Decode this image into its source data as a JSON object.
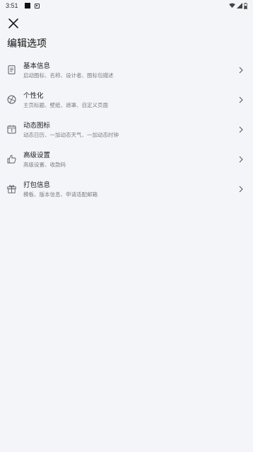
{
  "status": {
    "time": "3:51",
    "icons": [
      "notification-square-icon",
      "notification-box-icon",
      "wifi-icon",
      "signal-icon",
      "battery-icon"
    ]
  },
  "header": {
    "close_icon": "close-icon",
    "title": "编辑选项"
  },
  "menu": [
    {
      "icon": "document-icon",
      "label": "基本信息",
      "sub": "启动图标、名称、设计者、图标包描述"
    },
    {
      "icon": "palette-icon",
      "label": "个性化",
      "sub": "主页标题、壁纸、遮罩、自定义页面"
    },
    {
      "icon": "calendar-icon",
      "label": "动态图标",
      "sub": "动态日历、一加动态天气、一加动态时钟"
    },
    {
      "icon": "thumb-up-icon",
      "label": "高级设置",
      "sub": "高级设置、收款码"
    },
    {
      "icon": "gift-icon",
      "label": "打包信息",
      "sub": "模板、版本信息、申请适配邮箱"
    }
  ],
  "colors": {
    "background": "#f4f5f8",
    "text_primary": "#1d1d1f",
    "text_secondary": "#7b7d82",
    "icon": "#555a63"
  }
}
